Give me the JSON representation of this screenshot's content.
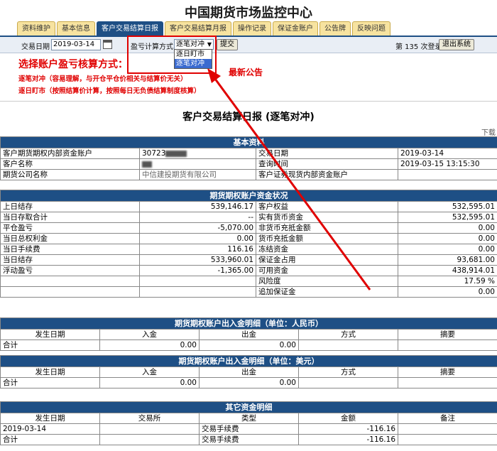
{
  "app_title": "中国期货市场监控中心",
  "tabs": [
    "资料维护",
    "基本信息",
    "客户交易结算日报",
    "客户交易结算月报",
    "操作记录",
    "保证金账户",
    "公告牌",
    "反映问题"
  ],
  "toolbar": {
    "date_label": "交易日期",
    "date_value": "2019-03-14",
    "calc_label": "盈亏计算方式",
    "calc_selected": "逐笔对冲",
    "calc_options": [
      "逐日盯市",
      "逐笔对冲"
    ],
    "submit_label": "提交",
    "login_count": "第 135 次登录",
    "logout_label": "退出系统"
  },
  "notes": {
    "title": "选择账户盈亏核算方式：",
    "line1": "逐笔对冲（容易理解，与开仓平仓价相关与结算价无关）",
    "line2": "逐日盯市（按照结算价计算，按照每日无负债结算制度核算）",
    "latest": "最新公告"
  },
  "report": {
    "title": "客户交易结算日报 (逐笔对冲)",
    "download": "下载"
  },
  "basic": {
    "section": "基本资料",
    "acct_label": "客户期货期权内部资金账户",
    "acct_value": "30723",
    "trade_date_label": "交易日期",
    "trade_date_value": "2019-03-14",
    "name_label": "客户名称",
    "query_time_label": "查询时间",
    "query_time_value": "2019-03-15 13:15:30",
    "company_label": "期货公司名称",
    "company_value": "中信建投期货有限公司",
    "sec_acct_label": "客户证券现货内部资金账户"
  },
  "funds": {
    "section": "期货期权账户资金状况",
    "left": [
      {
        "label": "上日结存",
        "value": "539,146.17"
      },
      {
        "label": "当日存取合计",
        "value": "--"
      },
      {
        "label": "平仓盈亏",
        "value": "-5,070.00"
      },
      {
        "label": "当日总权利金",
        "value": "0.00"
      },
      {
        "label": "当日手续费",
        "value": "116.16"
      },
      {
        "label": "当日结存",
        "value": "533,960.01"
      },
      {
        "label": "浮动盈亏",
        "value": "-1,365.00"
      },
      {
        "label": "",
        "value": ""
      },
      {
        "label": "",
        "value": ""
      }
    ],
    "right": [
      {
        "label": "客户权益",
        "value": "532,595.01"
      },
      {
        "label": "实有货币资金",
        "value": "532,595.01"
      },
      {
        "label": "非货币充抵金额",
        "value": "0.00"
      },
      {
        "label": "货币充抵金额",
        "value": "0.00"
      },
      {
        "label": "冻结资金",
        "value": "0.00"
      },
      {
        "label": "保证金占用",
        "value": "93,681.00"
      },
      {
        "label": "可用资金",
        "value": "438,914.01"
      },
      {
        "label": "风险度",
        "value": "17.59 %"
      },
      {
        "label": "追加保证金",
        "value": "0.00"
      }
    ]
  },
  "rmb": {
    "section": "期货期权账户出入金明细（单位：人民币）",
    "headers": [
      "发生日期",
      "入金",
      "出金",
      "方式",
      "摘要"
    ],
    "total_label": "合计",
    "total_in": "0.00",
    "total_out": "0.00"
  },
  "usd": {
    "section": "期货期权账户出入金明细（单位：美元）",
    "headers": [
      "发生日期",
      "入金",
      "出金",
      "方式",
      "摘要"
    ],
    "total_label": "合计",
    "total_in": "0.00",
    "total_out": "0.00"
  },
  "other": {
    "section": "其它资金明细",
    "headers": [
      "发生日期",
      "交易所",
      "类型",
      "金额",
      "备注"
    ],
    "row": {
      "date": "2019-03-14",
      "type": "交易手续费",
      "amount": "-116.16"
    },
    "total": {
      "label": "合计",
      "type": "交易手续费",
      "amount": "-116.16"
    }
  },
  "colors": {
    "header_blue": "#1e4f85",
    "accent_red": "#e00000",
    "tab_yellow": "#f7e3a0"
  }
}
